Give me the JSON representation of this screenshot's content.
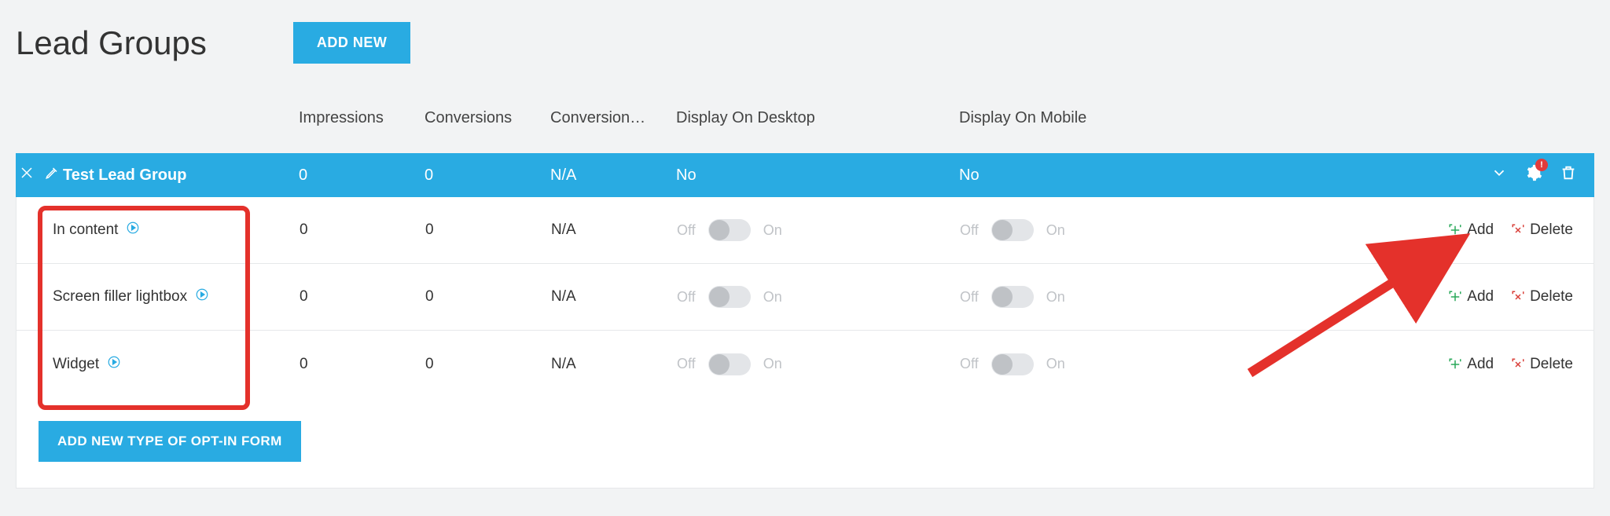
{
  "page": {
    "title": "Lead Groups",
    "add_new_btn": "ADD NEW",
    "add_type_btn": "ADD NEW TYPE OF OPT-IN FORM"
  },
  "columns": {
    "impressions": "Impressions",
    "conversions": "Conversions",
    "conversion_rate": "Conversion…",
    "display_desktop": "Display On Desktop",
    "display_mobile": "Display On Mobile"
  },
  "group": {
    "name": "Test Lead Group",
    "impressions": "0",
    "conversions": "0",
    "conversion_rate": "N/A",
    "display_desktop": "No",
    "display_mobile": "No",
    "gear_badge": "!"
  },
  "toggle_labels": {
    "off": "Off",
    "on": "On"
  },
  "row_actions": {
    "add": "Add",
    "delete": "Delete"
  },
  "rows": [
    {
      "name": "In content",
      "impressions": "0",
      "conversions": "0",
      "conversion_rate": "N/A"
    },
    {
      "name": "Screen filler lightbox",
      "impressions": "0",
      "conversions": "0",
      "conversion_rate": "N/A"
    },
    {
      "name": "Widget",
      "impressions": "0",
      "conversions": "0",
      "conversion_rate": "N/A"
    }
  ],
  "colors": {
    "primary": "#29abe2",
    "danger": "#e4312b",
    "success": "#2aa85a"
  }
}
